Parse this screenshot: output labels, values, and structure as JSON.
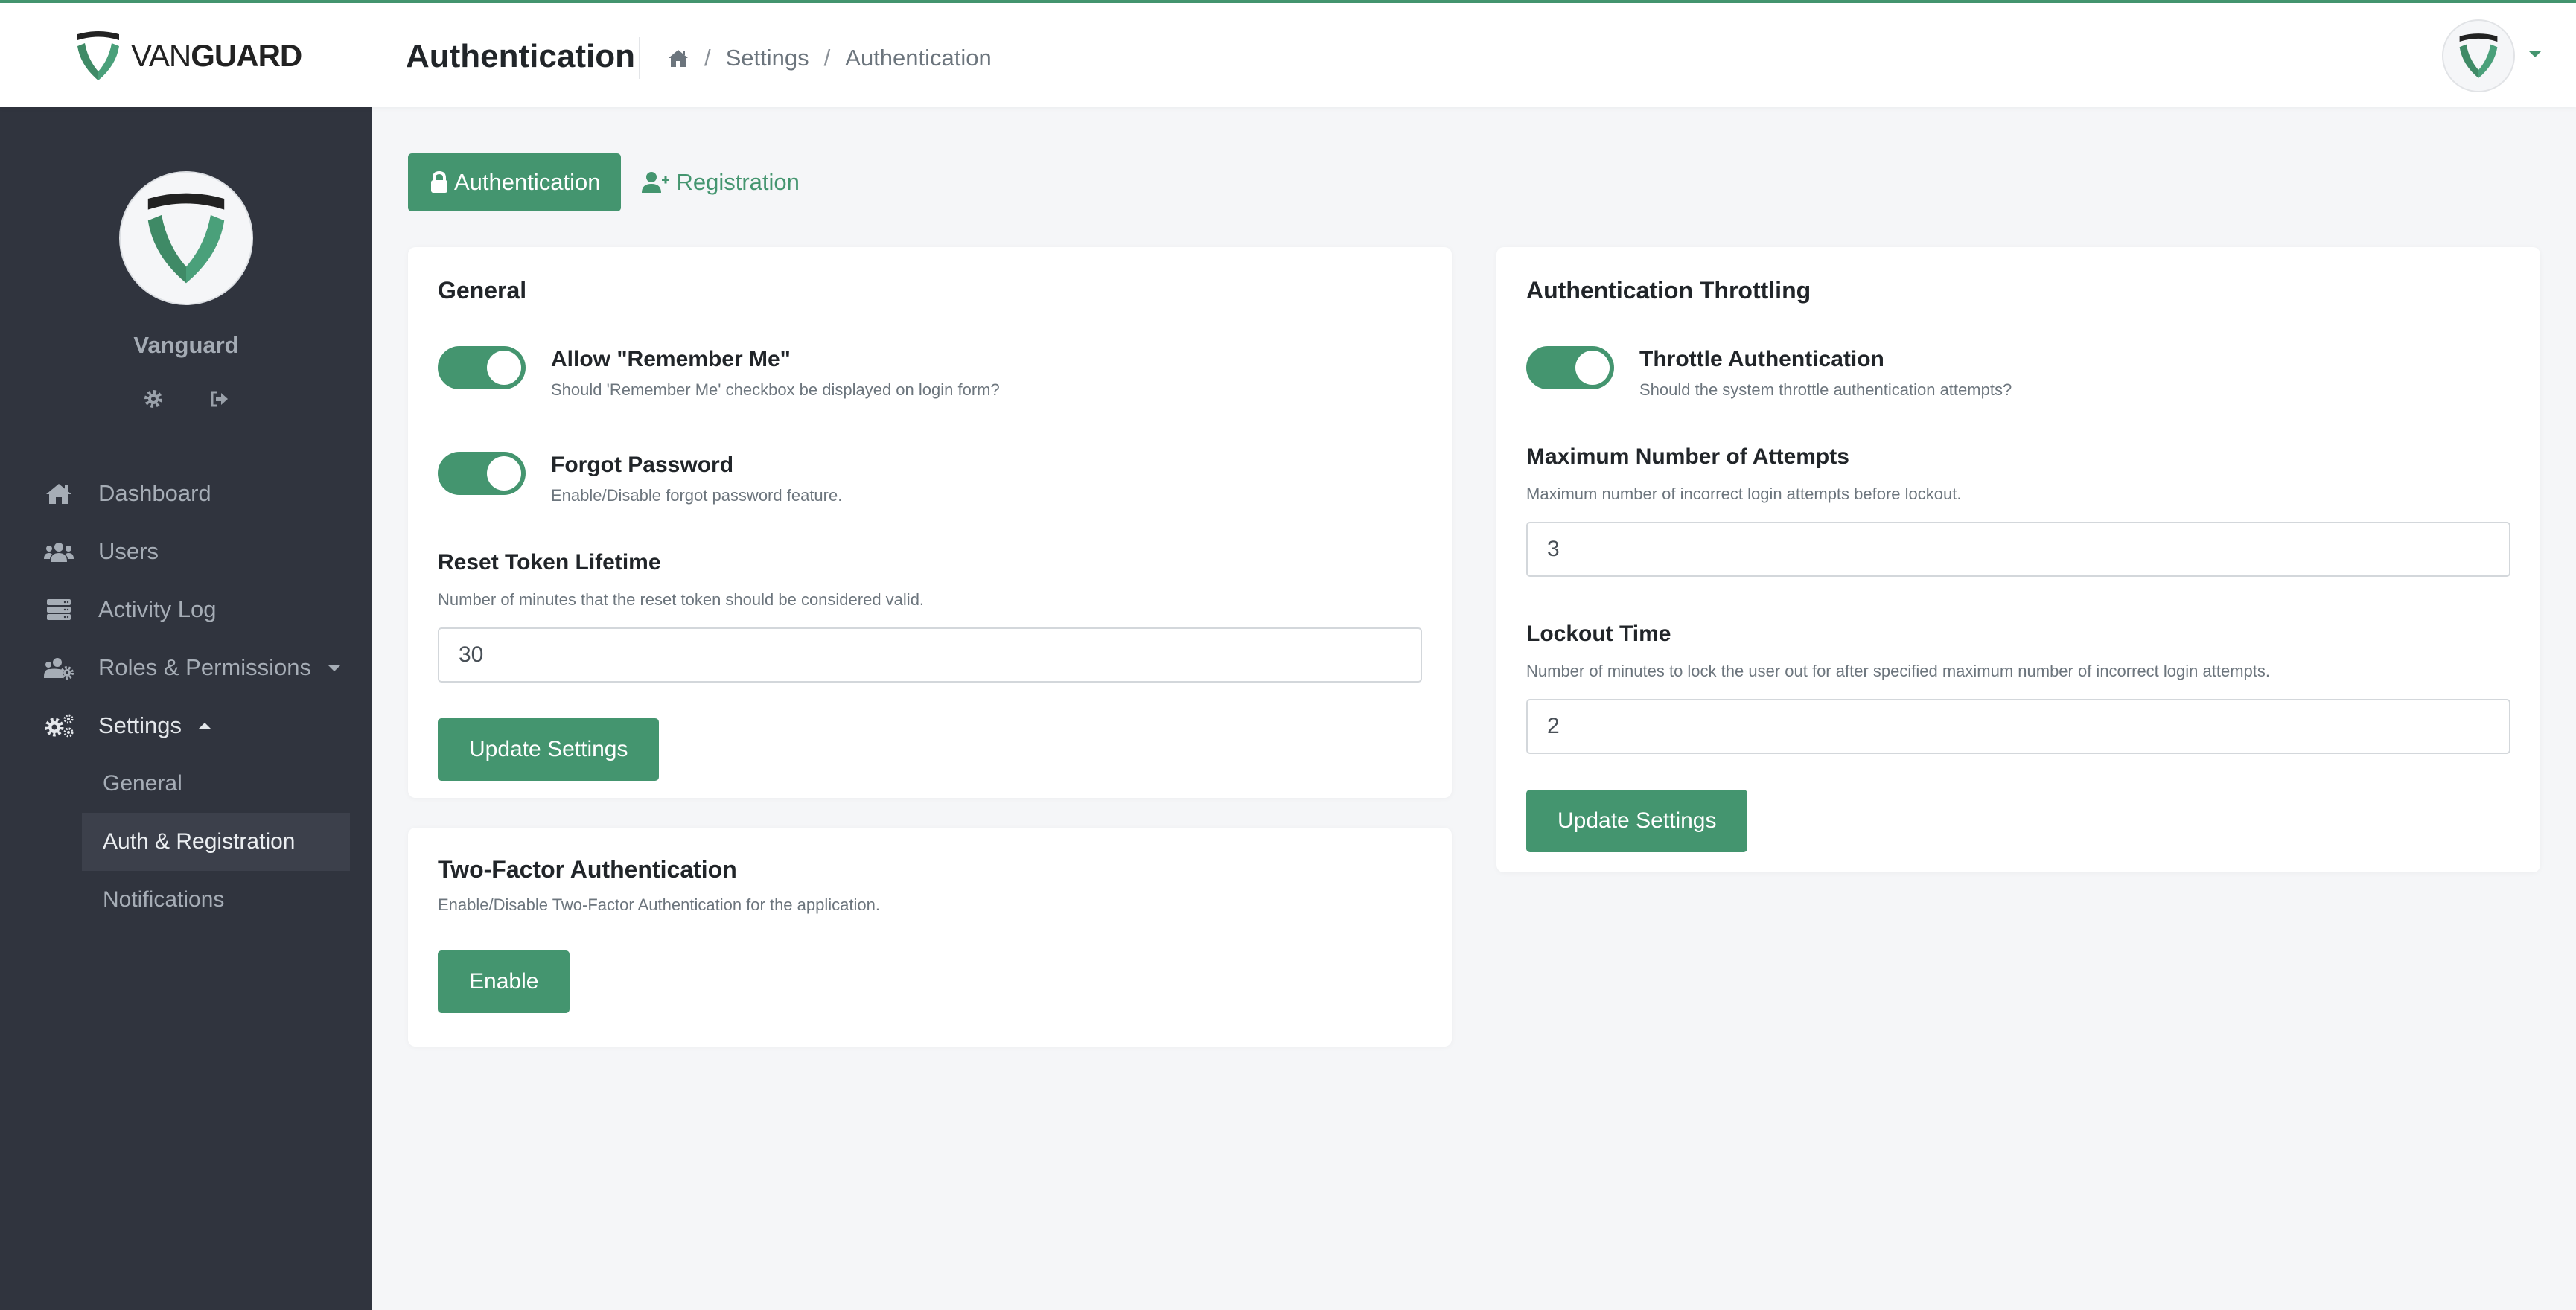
{
  "app": {
    "brand_light": "VAN",
    "brand_bold": "GUARD",
    "accent_color": "#44956f",
    "sidebar_color": "#30343e"
  },
  "header": {
    "title": "Authentication",
    "breadcrumb": [
      {
        "icon": "home-icon"
      },
      {
        "label": "Settings"
      },
      {
        "label": "Authentication"
      }
    ],
    "separator": "/"
  },
  "sidebar": {
    "profile_name": "Vanguard",
    "profile_actions": [
      "gear-icon",
      "sign-out-icon"
    ],
    "items": [
      {
        "label": "Dashboard",
        "icon": "home-icon"
      },
      {
        "label": "Users",
        "icon": "users-icon"
      },
      {
        "label": "Activity Log",
        "icon": "server-icon"
      },
      {
        "label": "Roles & Permissions",
        "icon": "users-cog-icon",
        "caret": "down"
      },
      {
        "label": "Settings",
        "icon": "cogs-icon",
        "caret": "up",
        "expanded": true
      }
    ],
    "subitems": [
      {
        "label": "General",
        "active": false
      },
      {
        "label": "Auth & Registration",
        "active": true
      },
      {
        "label": "Notifications",
        "active": false
      }
    ]
  },
  "tabs": [
    {
      "label": "Authentication",
      "icon": "lock-icon",
      "active": true
    },
    {
      "label": "Registration",
      "icon": "user-plus-icon",
      "active": false
    }
  ],
  "general_card": {
    "title": "General",
    "toggles": [
      {
        "label": "Allow \"Remember Me\"",
        "description": "Should 'Remember Me' checkbox be displayed on login form?",
        "checked": true
      },
      {
        "label": "Forgot Password",
        "description": "Enable/Disable forgot password feature.",
        "checked": true
      }
    ],
    "field": {
      "label": "Reset Token Lifetime",
      "help": "Number of minutes that the reset token should be considered valid.",
      "value": "30"
    },
    "button": "Update Settings"
  },
  "two_factor_card": {
    "title": "Two-Factor Authentication",
    "description": "Enable/Disable Two-Factor Authentication for the application.",
    "button": "Enable"
  },
  "throttle_card": {
    "title": "Authentication Throttling",
    "toggle": {
      "label": "Throttle Authentication",
      "description": "Should the system throttle authentication attempts?",
      "checked": true
    },
    "fields": [
      {
        "label": "Maximum Number of Attempts",
        "help": "Maximum number of incorrect login attempts before lockout.",
        "value": "3"
      },
      {
        "label": "Lockout Time",
        "help": "Number of minutes to lock the user out for after specified maximum number of incorrect login attempts.",
        "value": "2"
      }
    ],
    "button": "Update Settings"
  }
}
